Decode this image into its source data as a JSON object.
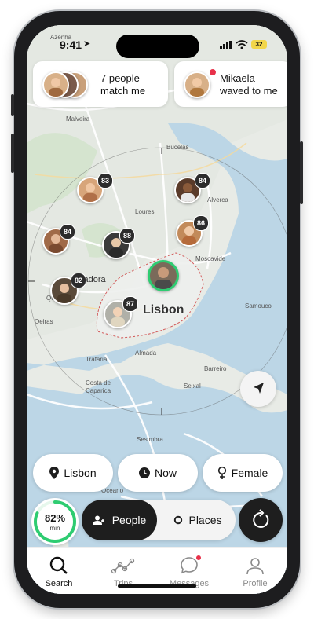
{
  "status_bar": {
    "time": "9:41",
    "battery": "32"
  },
  "notifications": [
    {
      "text_line1": "7 people",
      "text_line2": "match me"
    },
    {
      "text_line1": "Mikaela",
      "text_line2": "waved to me"
    }
  ],
  "map": {
    "city_label": "Lisbon",
    "places": [
      "Azenha",
      "Malveira",
      "Bucelas",
      "Loures",
      "Amadora",
      "Queluz",
      "Moscavide",
      "Barreiro",
      "Trafaria",
      "Almada",
      "Costa de Caparica",
      "Seixal",
      "Samouco",
      "Oeiras"
    ],
    "markers": [
      {
        "badge": "83"
      },
      {
        "badge": "84"
      },
      {
        "badge": "84"
      },
      {
        "badge": "88"
      },
      {
        "badge": "86"
      },
      {
        "badge": "82"
      },
      {
        "badge": "87"
      }
    ]
  },
  "filters": {
    "location": "Lisbon",
    "time": "Now",
    "gender": "Female"
  },
  "match": {
    "percent": "82%",
    "unit": "min",
    "progress": 0.82
  },
  "mode": {
    "people": "People",
    "places": "Places",
    "active": "People"
  },
  "tabs": [
    {
      "label": "Search",
      "icon": "search-icon",
      "active": true
    },
    {
      "label": "Trips",
      "icon": "trips-icon",
      "active": false
    },
    {
      "label": "Messages",
      "icon": "messages-icon",
      "active": false
    },
    {
      "label": "Profile",
      "icon": "profile-icon",
      "active": false
    }
  ],
  "colors": {
    "accent": "#2ecc71",
    "dark": "#1e1e1e",
    "water": "#bcd6e6",
    "land": "#e9ecef"
  }
}
